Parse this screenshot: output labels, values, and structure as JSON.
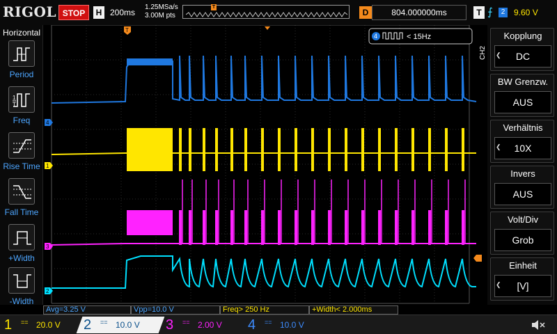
{
  "topbar": {
    "logo": "RIGOL",
    "run_state": "STOP",
    "timebase_badge": "H",
    "timebase": "200ms",
    "sample_rate": "1.25MSa/s",
    "memory_depth": "3.00M pts",
    "trigger_marker": "T",
    "delay_badge": "D",
    "delay": "804.000000ms",
    "trigger_badge": "T",
    "trigger_edge": "rising-edge-icon",
    "trigger_channel": "2",
    "trigger_level": "9.60 V"
  },
  "left_panel": {
    "title": "Horizontal",
    "buttons": [
      {
        "label": "Period",
        "icon": "period-icon"
      },
      {
        "label": "Freq",
        "icon": "frequency-icon"
      },
      {
        "label": "Rise Time",
        "icon": "rise-time-icon"
      },
      {
        "label": "Fall Time",
        "icon": "fall-time-icon"
      },
      {
        "label": "+Width",
        "icon": "positive-width-icon"
      },
      {
        "label": "-Width",
        "icon": "negative-width-icon"
      }
    ]
  },
  "grid": {
    "trigger_position_marker": "T",
    "ch4_frequency_label": "< 15Hz",
    "ch4_frequency_channel": "4",
    "channel_markers": [
      "4",
      "1",
      "3",
      "2"
    ]
  },
  "right_menu": {
    "channel": "CH2",
    "items": [
      {
        "label": "Kopplung",
        "value": "DC"
      },
      {
        "label": "BW Grenzw.",
        "value": "AUS"
      },
      {
        "label": "Verhältnis",
        "value": "10X"
      },
      {
        "label": "Invers",
        "value": "AUS"
      },
      {
        "label": "Volt/Div",
        "value": "Grob"
      },
      {
        "label": "Einheit",
        "value": "[V]"
      }
    ]
  },
  "measurements": [
    {
      "text": "Avg=3.25 V",
      "color": "#4da6ff"
    },
    {
      "text": "Vpp=10.0 V",
      "color": "#4da6ff"
    },
    {
      "text": "Freq> 250 Hz",
      "color": "#ffe600"
    },
    {
      "text": "+Width< 2.000ms",
      "color": "#ffe600"
    }
  ],
  "channels": [
    {
      "num": "1",
      "coupling": "==",
      "scale": "20.0 V",
      "color": "#ffe600"
    },
    {
      "num": "2",
      "coupling": "==",
      "scale": "10.0 V",
      "color": "#00e0ff"
    },
    {
      "num": "3",
      "coupling": "==",
      "scale": "2.00 V",
      "color": "#ff22ff"
    },
    {
      "num": "4",
      "coupling": "==",
      "scale": "10.0 V",
      "color": "#3d8cff"
    }
  ],
  "colors": {
    "ch1": "#ffe600",
    "ch2": "#00e0ff",
    "ch3": "#ff22ff",
    "ch4": "#1f78e0",
    "trigger": "#f58a1c",
    "stop": "#d01010"
  }
}
